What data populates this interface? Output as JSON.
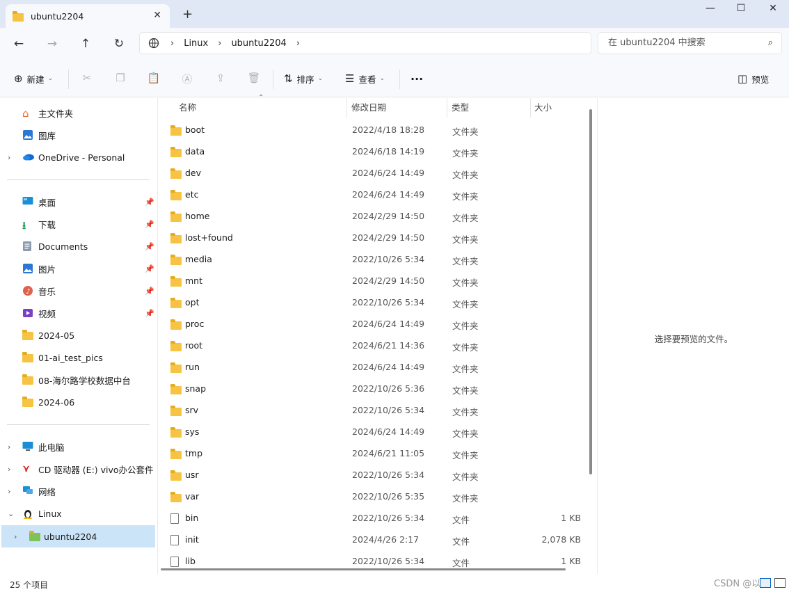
{
  "window": {
    "tab_title": "ubuntu2204",
    "tab_close": "✕",
    "new_tab": "+",
    "minimize": "—",
    "maximize": "☐",
    "close": "✕"
  },
  "nav": {
    "back": "←",
    "forward": "→",
    "up": "↑",
    "refresh": "↻",
    "breadcrumb": [
      "Linux",
      "ubuntu2204"
    ],
    "search_placeholder": "在 ubuntu2204 中搜索"
  },
  "toolbar": {
    "new_label": "新建",
    "sort_label": "排序",
    "view_label": "查看",
    "more_label": "···",
    "preview_label": "预览"
  },
  "sidebar": {
    "top": [
      {
        "label": "主文件夹",
        "icon": "home-icon"
      },
      {
        "label": "图库",
        "icon": "gallery-icon"
      },
      {
        "label": "OneDrive - Personal",
        "icon": "onedrive-icon"
      }
    ],
    "quick": [
      {
        "label": "桌面",
        "icon": "desktop-icon"
      },
      {
        "label": "下载",
        "icon": "download-icon"
      },
      {
        "label": "Documents",
        "icon": "documents-icon"
      },
      {
        "label": "图片",
        "icon": "pictures-icon"
      },
      {
        "label": "音乐",
        "icon": "music-icon"
      },
      {
        "label": "视频",
        "icon": "videos-icon"
      },
      {
        "label": "2024-05",
        "icon": "folder-icon"
      },
      {
        "label": "01-ai_test_pics",
        "icon": "folder-icon"
      },
      {
        "label": "08-海尔路学校数据中台",
        "icon": "folder-icon"
      },
      {
        "label": "2024-06",
        "icon": "folder-icon"
      }
    ],
    "devices": [
      {
        "label": "此电脑",
        "icon": "pc-icon"
      },
      {
        "label": "CD 驱动器 (E:) vivo办公套件",
        "icon": "cd-drive-icon"
      },
      {
        "label": "网络",
        "icon": "network-icon"
      },
      {
        "label": "Linux",
        "icon": "linux-icon"
      },
      {
        "label": "ubuntu2204",
        "icon": "folder-icon"
      }
    ]
  },
  "columns": {
    "name": "名称",
    "date": "修改日期",
    "type": "类型",
    "size": "大小"
  },
  "files": [
    {
      "name": "boot",
      "date": "2022/4/18 18:28",
      "type": "文件夹",
      "size": "",
      "kind": "folder"
    },
    {
      "name": "data",
      "date": "2024/6/18 14:19",
      "type": "文件夹",
      "size": "",
      "kind": "folder"
    },
    {
      "name": "dev",
      "date": "2024/6/24 14:49",
      "type": "文件夹",
      "size": "",
      "kind": "folder"
    },
    {
      "name": "etc",
      "date": "2024/6/24 14:49",
      "type": "文件夹",
      "size": "",
      "kind": "folder"
    },
    {
      "name": "home",
      "date": "2024/2/29 14:50",
      "type": "文件夹",
      "size": "",
      "kind": "folder"
    },
    {
      "name": "lost+found",
      "date": "2024/2/29 14:50",
      "type": "文件夹",
      "size": "",
      "kind": "folder"
    },
    {
      "name": "media",
      "date": "2022/10/26 5:34",
      "type": "文件夹",
      "size": "",
      "kind": "folder"
    },
    {
      "name": "mnt",
      "date": "2024/2/29 14:50",
      "type": "文件夹",
      "size": "",
      "kind": "folder"
    },
    {
      "name": "opt",
      "date": "2022/10/26 5:34",
      "type": "文件夹",
      "size": "",
      "kind": "folder"
    },
    {
      "name": "proc",
      "date": "2024/6/24 14:49",
      "type": "文件夹",
      "size": "",
      "kind": "folder"
    },
    {
      "name": "root",
      "date": "2024/6/21 14:36",
      "type": "文件夹",
      "size": "",
      "kind": "folder"
    },
    {
      "name": "run",
      "date": "2024/6/24 14:49",
      "type": "文件夹",
      "size": "",
      "kind": "folder"
    },
    {
      "name": "snap",
      "date": "2022/10/26 5:36",
      "type": "文件夹",
      "size": "",
      "kind": "folder"
    },
    {
      "name": "srv",
      "date": "2022/10/26 5:34",
      "type": "文件夹",
      "size": "",
      "kind": "folder"
    },
    {
      "name": "sys",
      "date": "2024/6/24 14:49",
      "type": "文件夹",
      "size": "",
      "kind": "folder"
    },
    {
      "name": "tmp",
      "date": "2024/6/21 11:05",
      "type": "文件夹",
      "size": "",
      "kind": "folder"
    },
    {
      "name": "usr",
      "date": "2022/10/26 5:34",
      "type": "文件夹",
      "size": "",
      "kind": "folder"
    },
    {
      "name": "var",
      "date": "2022/10/26 5:35",
      "type": "文件夹",
      "size": "",
      "kind": "folder"
    },
    {
      "name": "bin",
      "date": "2022/10/26 5:34",
      "type": "文件",
      "size": "1 KB",
      "kind": "file"
    },
    {
      "name": "init",
      "date": "2024/4/26 2:17",
      "type": "文件",
      "size": "2,078 KB",
      "kind": "file"
    },
    {
      "name": "lib",
      "date": "2022/10/26 5:34",
      "type": "文件",
      "size": "1 KB",
      "kind": "file"
    }
  ],
  "preview_message": "选择要预览的文件。",
  "status": {
    "item_count": "25 个项目",
    "watermark": "CSDN @以墨"
  },
  "colors": {
    "titlebar": "#dfe8f4",
    "selected": "#cce4f7",
    "folder": "#f6c342"
  }
}
